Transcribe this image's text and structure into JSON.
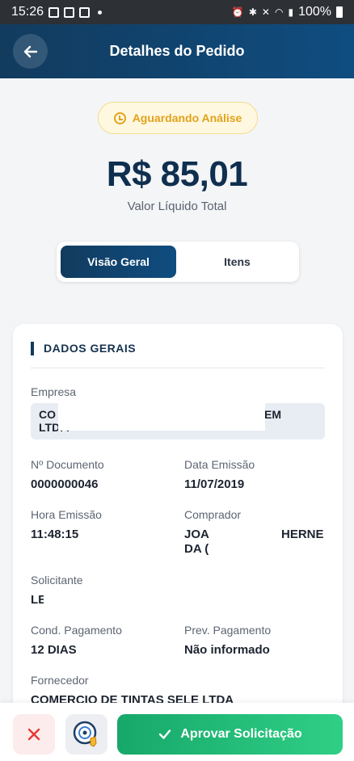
{
  "status_bar": {
    "time": "15:26",
    "battery": "100%"
  },
  "header": {
    "title": "Detalhes do Pedido"
  },
  "status_badge": {
    "label": "Aguardando Análise",
    "color": "#e1a21a"
  },
  "summary": {
    "total_value": "R$ 85,01",
    "total_label": "Valor Líquido Total"
  },
  "tabs": [
    {
      "label": "Visão Geral",
      "active": true
    },
    {
      "label": "Itens",
      "active": false
    }
  ],
  "section": {
    "title": "DADOS GERAIS",
    "fields": {
      "empresa_label": "Empresa",
      "empresa_value_start": "CO",
      "empresa_value_end": "AGEM",
      "empresa_value_line2": "LTD. .",
      "documento_label": "Nº Documento",
      "documento_value": "0000000046",
      "emissao_label": "Data Emissão",
      "emissao_value": "11/07/2019",
      "hora_label": "Hora Emissão",
      "hora_value": "11:48:15",
      "comprador_label": "Comprador",
      "comprador_value_l1a": "JOA",
      "comprador_value_l1b": "HERNE",
      "comprador_value_l2": "DA (",
      "solicitante_label": "Solicitante",
      "solicitante_value": "LE",
      "cond_label": "Cond. Pagamento",
      "cond_value": "12 DIAS",
      "prev_label": "Prev. Pagamento",
      "prev_value": "Não informado",
      "fornecedor_label": "Fornecedor",
      "fornecedor_value": "COMERCIO DE TINTAS SELE LTDA"
    }
  },
  "actions": {
    "approve_label": "Aprovar Solicitação"
  },
  "colors": {
    "primary": "#123b5e",
    "approve": "#1fb874",
    "cancel": "#e53935"
  }
}
